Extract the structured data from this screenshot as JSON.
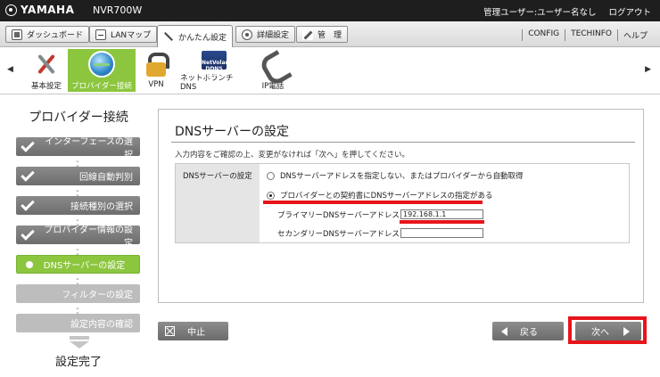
{
  "header": {
    "brand": "YAMAHA",
    "model": "NVR700W",
    "user": "管理ユーザー:ユーザー名なし",
    "logout": "ログアウト"
  },
  "tabs": [
    {
      "label": "ダッシュボード",
      "icon": "dashboard-icon"
    },
    {
      "label": "LANマップ",
      "icon": "lan-map-icon"
    },
    {
      "label": "かんたん設定",
      "icon": "wizard-icon",
      "active": true
    },
    {
      "label": "詳細設定",
      "icon": "gear-icon"
    },
    {
      "label": "管　理",
      "icon": "wrench-icon"
    }
  ],
  "top_links": [
    "CONFIG",
    "TECHINFO",
    "ヘルプ"
  ],
  "icon_strip": {
    "items": [
      {
        "label": "基本設定",
        "icon": "tools-icon"
      },
      {
        "label": "プロバイダー接続",
        "icon": "globe-icon",
        "selected": true
      },
      {
        "label": "VPN",
        "icon": "vpn-lock-icon"
      },
      {
        "label": "ネットボランチDNS",
        "icon": "ddns-icon",
        "icon_text": "NetVolante DDNS Service"
      },
      {
        "label": "IP電話",
        "icon": "phone-icon"
      }
    ]
  },
  "wizard": {
    "title": "プロバイダー接続",
    "steps": [
      {
        "label": "インターフェースの選択",
        "state": "done"
      },
      {
        "label": "回線自動判別",
        "state": "done"
      },
      {
        "label": "接続種別の選択",
        "state": "done"
      },
      {
        "label": "プロバイダー情報の設定",
        "state": "done"
      },
      {
        "label": "DNSサーバーの設定",
        "state": "current"
      },
      {
        "label": "フィルターの設定",
        "state": "todo"
      },
      {
        "label": "設定内容の確認",
        "state": "todo"
      }
    ],
    "final": "設定完了"
  },
  "panel": {
    "title": "DNSサーバーの設定",
    "description": "入力内容をご確認の上、変更がなければ「次へ」を押してください。",
    "form_label": "DNSサーバーの設定",
    "option_auto": "DNSサーバーアドレスを指定しない、またはプロバイダーから自動取得",
    "option_manual": "プロバイダーとの契約書にDNSサーバーアドレスの指定がある",
    "primary_label": "プライマリーDNSサーバーアドレス",
    "primary_value": "192.168.1.1",
    "secondary_label": "セカンダリーDNSサーバーアドレス",
    "secondary_value": ""
  },
  "buttons": {
    "cancel": "中止",
    "back": "戻る",
    "next": "次へ"
  },
  "colors": {
    "accent_green": "#8cc63f",
    "highlight_red": "#e8141a",
    "header_dark": "#1e1e1e"
  }
}
